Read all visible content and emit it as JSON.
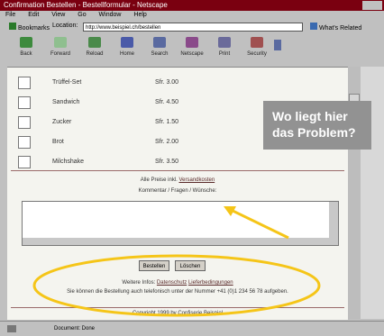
{
  "window": {
    "title": "Confirmation Bestellen - Bestellformular - Netscape",
    "menu": [
      "File",
      "Edit",
      "View",
      "Go",
      "Window",
      "Help"
    ]
  },
  "location_bar": {
    "bookmarks_label": "Bookmarks",
    "location_label": "Location:",
    "url": "http://www.beispiel.ch/bestellen",
    "whats_related": "What's Related"
  },
  "toolbar": {
    "buttons": [
      "Back",
      "Forward",
      "Reload",
      "Home",
      "Search",
      "Netscape",
      "Print",
      "Security"
    ]
  },
  "order_rows": [
    {
      "name": "Trüffel-Set",
      "price": "Sfr. 3.00"
    },
    {
      "name": "Sandwich",
      "price": "Sfr. 4.50"
    },
    {
      "name": "Zucker",
      "price": "Sfr. 1.50"
    },
    {
      "name": "Brot",
      "price": "Sfr. 2.00"
    },
    {
      "name": "Milchshake",
      "price": "Sfr. 3.50"
    }
  ],
  "form": {
    "total_text": "Alle Preise inkl.",
    "total_link": "Versandkosten",
    "comments_label": "Kommentar / Fragen / Wünsche:",
    "submit_button": "Bestellen",
    "reset_button": "Löschen",
    "info_prefix": "Weitere Infos:",
    "info_link_1": "Datenschutz",
    "info_link_2": "Lieferbedingungen",
    "phone_text": "Sie können die Bestellung auch telefonisch unter der Nummer +41 (0)1 234 56 78 aufgeben.",
    "copyright": "Copyright 1999 by Confiserie Beispiel"
  },
  "callout": {
    "line1": "Wo liegt hier",
    "line2": "das Problem?"
  },
  "status": {
    "text": "Document: Done"
  },
  "colors": {
    "title_bar": "#7a0010",
    "callout_bg": "#929292",
    "highlight": "#f5c518"
  }
}
